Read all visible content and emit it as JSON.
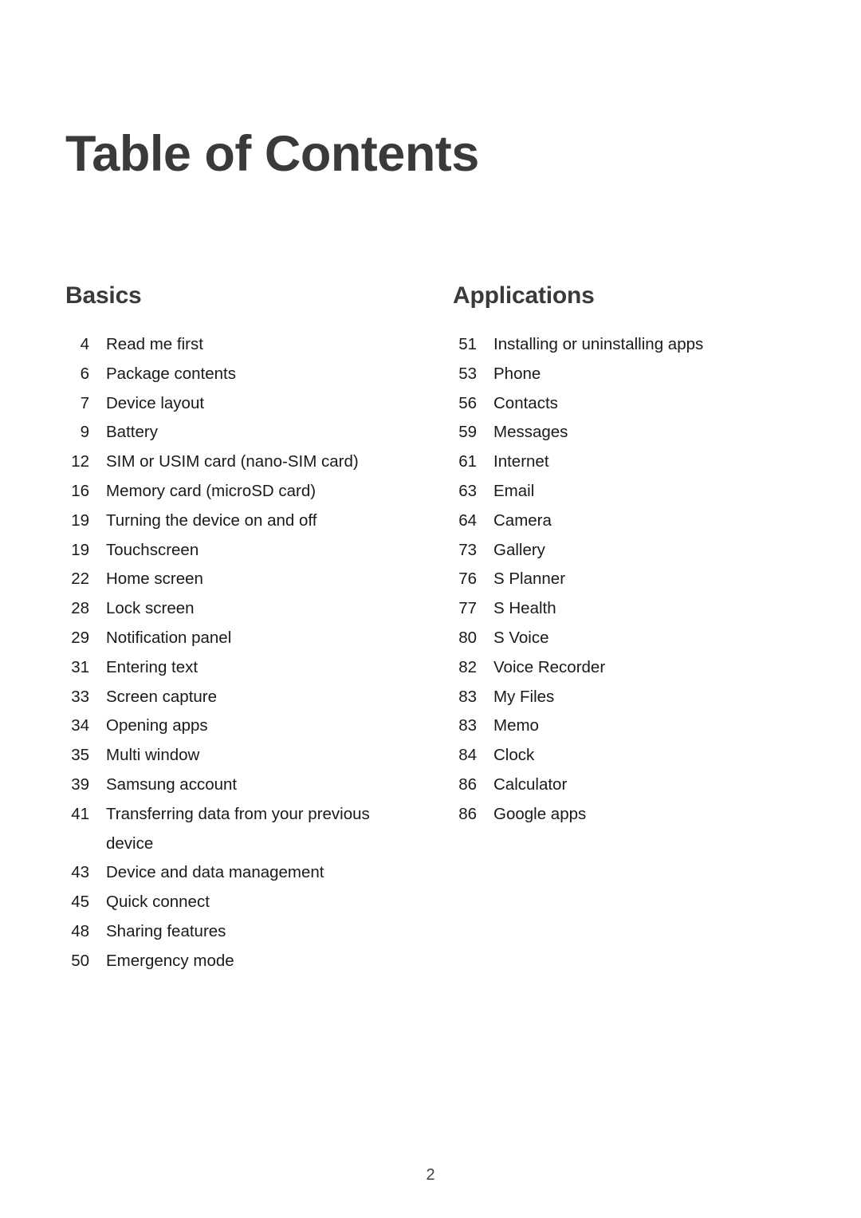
{
  "document": {
    "title": "Table of Contents",
    "page_number": "2"
  },
  "columns": [
    {
      "heading": "Basics",
      "entries": [
        {
          "page": "4",
          "title": "Read me first"
        },
        {
          "page": "6",
          "title": "Package contents"
        },
        {
          "page": "7",
          "title": "Device layout"
        },
        {
          "page": "9",
          "title": "Battery"
        },
        {
          "page": "12",
          "title": "SIM or USIM card (nano-SIM card)"
        },
        {
          "page": "16",
          "title": "Memory card (microSD card)"
        },
        {
          "page": "19",
          "title": "Turning the device on and off"
        },
        {
          "page": "19",
          "title": "Touchscreen"
        },
        {
          "page": "22",
          "title": "Home screen"
        },
        {
          "page": "28",
          "title": "Lock screen"
        },
        {
          "page": "29",
          "title": "Notification panel"
        },
        {
          "page": "31",
          "title": "Entering text"
        },
        {
          "page": "33",
          "title": "Screen capture"
        },
        {
          "page": "34",
          "title": "Opening apps"
        },
        {
          "page": "35",
          "title": "Multi window"
        },
        {
          "page": "39",
          "title": "Samsung account"
        },
        {
          "page": "41",
          "title": "Transferring data from your previous device"
        },
        {
          "page": "43",
          "title": "Device and data management"
        },
        {
          "page": "45",
          "title": "Quick connect"
        },
        {
          "page": "48",
          "title": "Sharing features"
        },
        {
          "page": "50",
          "title": "Emergency mode"
        }
      ]
    },
    {
      "heading": "Applications",
      "entries": [
        {
          "page": "51",
          "title": "Installing or uninstalling apps"
        },
        {
          "page": "53",
          "title": "Phone"
        },
        {
          "page": "56",
          "title": "Contacts"
        },
        {
          "page": "59",
          "title": "Messages"
        },
        {
          "page": "61",
          "title": "Internet"
        },
        {
          "page": "63",
          "title": "Email"
        },
        {
          "page": "64",
          "title": "Camera"
        },
        {
          "page": "73",
          "title": "Gallery"
        },
        {
          "page": "76",
          "title": "S Planner"
        },
        {
          "page": "77",
          "title": "S Health"
        },
        {
          "page": "80",
          "title": "S Voice"
        },
        {
          "page": "82",
          "title": "Voice Recorder"
        },
        {
          "page": "83",
          "title": "My Files"
        },
        {
          "page": "83",
          "title": "Memo"
        },
        {
          "page": "84",
          "title": "Clock"
        },
        {
          "page": "86",
          "title": "Calculator"
        },
        {
          "page": "86",
          "title": "Google apps"
        }
      ]
    }
  ],
  "colors": {
    "heading": "#3a3a3a",
    "body_text": "#1a1a1a",
    "background": "#ffffff"
  }
}
